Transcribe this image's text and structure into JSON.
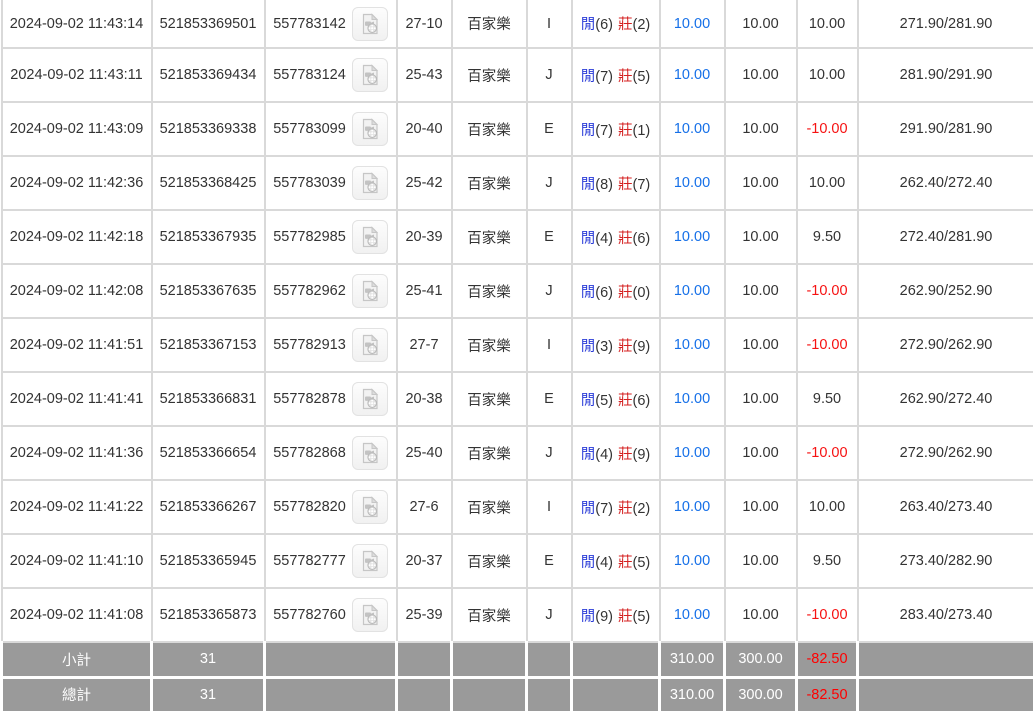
{
  "table": {
    "rows": [
      {
        "time": "2024-09-02 11:43:14",
        "bet_id": "521853369501",
        "game_id": "557783142",
        "round": "27-10",
        "game": "百家樂",
        "letter": "I",
        "player_label": "閒",
        "player_points": "(6)",
        "banker_label": "莊",
        "banker_points": "(2)",
        "valid_bet": "10.00",
        "bet_amount": "10.00",
        "win_loss": "10.00",
        "balance": "271.90/281.90"
      },
      {
        "time": "2024-09-02 11:43:11",
        "bet_id": "521853369434",
        "game_id": "557783124",
        "round": "25-43",
        "game": "百家樂",
        "letter": "J",
        "player_label": "閒",
        "player_points": "(7)",
        "banker_label": "莊",
        "banker_points": "(5)",
        "valid_bet": "10.00",
        "bet_amount": "10.00",
        "win_loss": "10.00",
        "balance": "281.90/291.90"
      },
      {
        "time": "2024-09-02 11:43:09",
        "bet_id": "521853369338",
        "game_id": "557783099",
        "round": "20-40",
        "game": "百家樂",
        "letter": "E",
        "player_label": "閒",
        "player_points": "(7)",
        "banker_label": "莊",
        "banker_points": "(1)",
        "valid_bet": "10.00",
        "bet_amount": "10.00",
        "win_loss": "-10.00",
        "balance": "291.90/281.90"
      },
      {
        "time": "2024-09-02 11:42:36",
        "bet_id": "521853368425",
        "game_id": "557783039",
        "round": "25-42",
        "game": "百家樂",
        "letter": "J",
        "player_label": "閒",
        "player_points": "(8)",
        "banker_label": "莊",
        "banker_points": "(7)",
        "valid_bet": "10.00",
        "bet_amount": "10.00",
        "win_loss": "10.00",
        "balance": "262.40/272.40"
      },
      {
        "time": "2024-09-02 11:42:18",
        "bet_id": "521853367935",
        "game_id": "557782985",
        "round": "20-39",
        "game": "百家樂",
        "letter": "E",
        "player_label": "閒",
        "player_points": "(4)",
        "banker_label": "莊",
        "banker_points": "(6)",
        "valid_bet": "10.00",
        "bet_amount": "10.00",
        "win_loss": "9.50",
        "balance": "272.40/281.90"
      },
      {
        "time": "2024-09-02 11:42:08",
        "bet_id": "521853367635",
        "game_id": "557782962",
        "round": "25-41",
        "game": "百家樂",
        "letter": "J",
        "player_label": "閒",
        "player_points": "(6)",
        "banker_label": "莊",
        "banker_points": "(0)",
        "valid_bet": "10.00",
        "bet_amount": "10.00",
        "win_loss": "-10.00",
        "balance": "262.90/252.90"
      },
      {
        "time": "2024-09-02 11:41:51",
        "bet_id": "521853367153",
        "game_id": "557782913",
        "round": "27-7",
        "game": "百家樂",
        "letter": "I",
        "player_label": "閒",
        "player_points": "(3)",
        "banker_label": "莊",
        "banker_points": "(9)",
        "valid_bet": "10.00",
        "bet_amount": "10.00",
        "win_loss": "-10.00",
        "balance": "272.90/262.90"
      },
      {
        "time": "2024-09-02 11:41:41",
        "bet_id": "521853366831",
        "game_id": "557782878",
        "round": "20-38",
        "game": "百家樂",
        "letter": "E",
        "player_label": "閒",
        "player_points": "(5)",
        "banker_label": "莊",
        "banker_points": "(6)",
        "valid_bet": "10.00",
        "bet_amount": "10.00",
        "win_loss": "9.50",
        "balance": "262.90/272.40"
      },
      {
        "time": "2024-09-02 11:41:36",
        "bet_id": "521853366654",
        "game_id": "557782868",
        "round": "25-40",
        "game": "百家樂",
        "letter": "J",
        "player_label": "閒",
        "player_points": "(4)",
        "banker_label": "莊",
        "banker_points": "(9)",
        "valid_bet": "10.00",
        "bet_amount": "10.00",
        "win_loss": "-10.00",
        "balance": "272.90/262.90"
      },
      {
        "time": "2024-09-02 11:41:22",
        "bet_id": "521853366267",
        "game_id": "557782820",
        "round": "27-6",
        "game": "百家樂",
        "letter": "I",
        "player_label": "閒",
        "player_points": "(7)",
        "banker_label": "莊",
        "banker_points": "(2)",
        "valid_bet": "10.00",
        "bet_amount": "10.00",
        "win_loss": "10.00",
        "balance": "263.40/273.40"
      },
      {
        "time": "2024-09-02 11:41:10",
        "bet_id": "521853365945",
        "game_id": "557782777",
        "round": "20-37",
        "game": "百家樂",
        "letter": "E",
        "player_label": "閒",
        "player_points": "(4)",
        "banker_label": "莊",
        "banker_points": "(5)",
        "valid_bet": "10.00",
        "bet_amount": "10.00",
        "win_loss": "9.50",
        "balance": "273.40/282.90"
      },
      {
        "time": "2024-09-02 11:41:08",
        "bet_id": "521853365873",
        "game_id": "557782760",
        "round": "25-39",
        "game": "百家樂",
        "letter": "J",
        "player_label": "閒",
        "player_points": "(9)",
        "banker_label": "莊",
        "banker_points": "(5)",
        "valid_bet": "10.00",
        "bet_amount": "10.00",
        "win_loss": "-10.00",
        "balance": "283.40/273.40"
      }
    ],
    "footer_rows": [
      {
        "label": "小計",
        "count": "31",
        "valid_bet": "310.00",
        "bet_amount": "300.00",
        "win_loss": "-82.50",
        "balance": ""
      },
      {
        "label": "總計",
        "count": "31",
        "valid_bet": "310.00",
        "bet_amount": "300.00",
        "win_loss": "-82.50",
        "balance": ""
      }
    ]
  },
  "icons": {
    "video_replay": "video-file-icon"
  },
  "colors": {
    "border": "#d9d9d9",
    "valid_bet_blue": "#1670e8",
    "player_blue": "#2b3dd8",
    "banker_red": "#d42222",
    "negative_red": "#f61212",
    "footer_bg": "#9a9a9a",
    "footer_negative": "#ff0000",
    "footer_text": "#ffffff"
  }
}
